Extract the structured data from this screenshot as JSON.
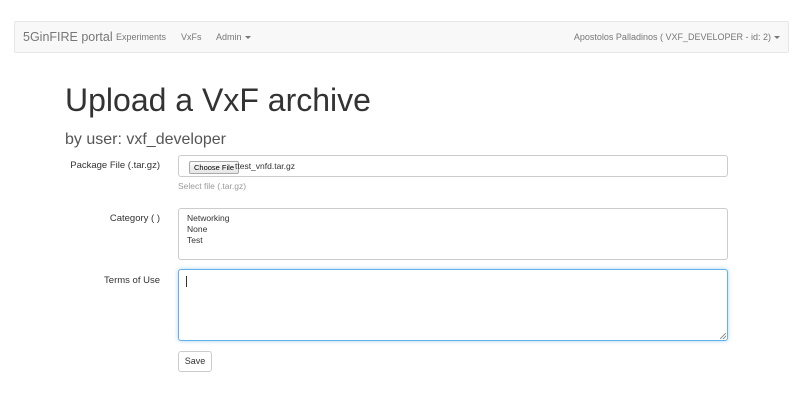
{
  "navbar": {
    "brand": "5GinFIRE portal",
    "items": [
      {
        "label": "Experiments"
      },
      {
        "label": "VxFs"
      },
      {
        "label": "Admin"
      }
    ],
    "user": "Apostolos Palladinos ( VXF_DEVELOPER - id: 2)"
  },
  "page": {
    "title": "Upload a VxF archive",
    "subtitle": "by user: vxf_developer"
  },
  "form": {
    "package_file": {
      "label": "Package File (.tar.gz)",
      "button_label": "Choose File",
      "file_name": "ttest_vnfd.tar.gz",
      "help": "Select file (.tar.gz)"
    },
    "category": {
      "label": "Category ( )",
      "options": [
        "Networking",
        "None",
        "Test"
      ]
    },
    "terms": {
      "label": "Terms of Use",
      "value": ""
    },
    "save_label": "Save"
  }
}
